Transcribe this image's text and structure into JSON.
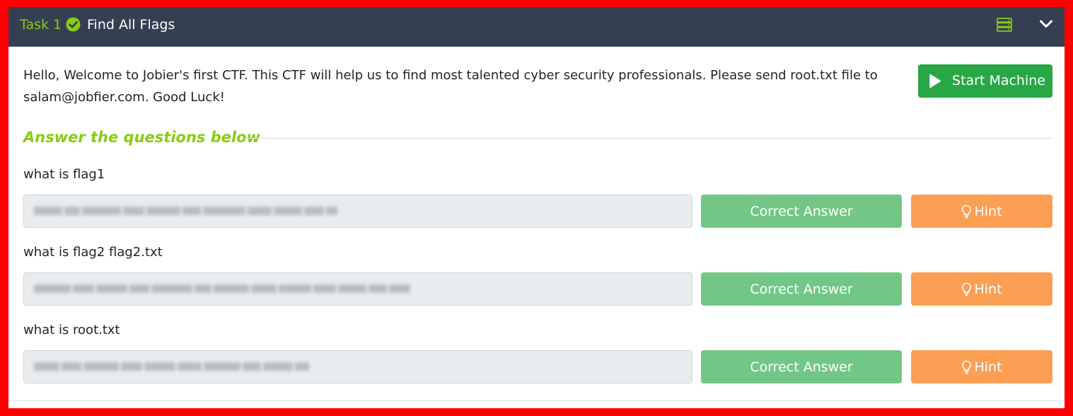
{
  "task": {
    "number_label": "Task 1",
    "title": "Find All Flags",
    "completed": true,
    "accent_color": "#88cc14",
    "header_bg": "#343f52"
  },
  "description": "Hello, Welcome to Jobier's first CTF. This CTF will help us to find most talented cyber security professionals. Please send root.txt file to salam@jobfier.com. Good Luck!",
  "start_machine": {
    "label": "Start Machine",
    "color": "#28a745"
  },
  "answers_heading": "Answer the questions below",
  "questions": [
    {
      "label": "what is flag1",
      "answer_obscured": true,
      "correct_label": "Correct Answer",
      "hint_label": "Hint"
    },
    {
      "label": "what is flag2 flag2.txt",
      "answer_obscured": true,
      "correct_label": "Correct Answer",
      "hint_label": "Hint"
    },
    {
      "label": "what is root.txt",
      "answer_obscured": true,
      "correct_label": "Correct Answer",
      "hint_label": "Hint"
    }
  ],
  "icons": [
    "check-circle-icon",
    "server-icon",
    "chevron-down-icon",
    "play-icon",
    "lightbulb-icon"
  ],
  "colors": {
    "correct_button": "#72c786",
    "hint_button": "#fb9f54",
    "frame": "#ff0000"
  }
}
